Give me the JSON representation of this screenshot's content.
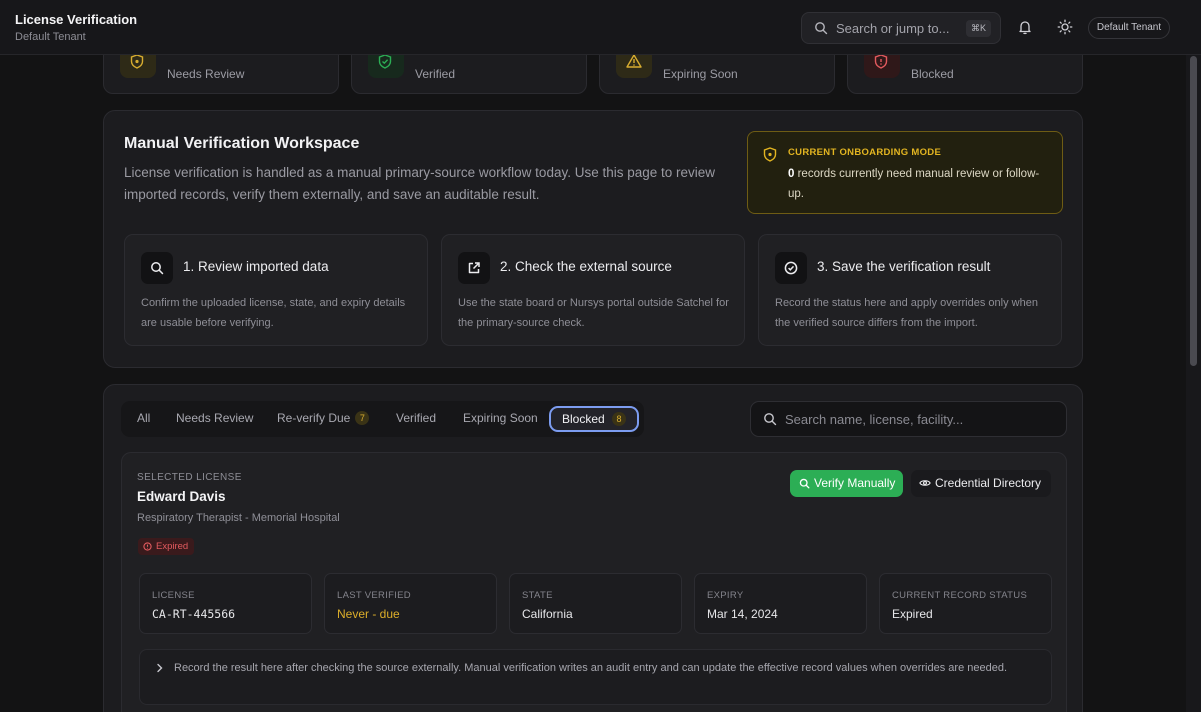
{
  "header": {
    "title": "License Verification",
    "subtitle": "Default Tenant",
    "search_placeholder": "Search or jump to...",
    "search_shortcut": "⌘K",
    "tenant_label": "Default Tenant",
    "icons": [
      "search-icon",
      "bell-icon",
      "sun-icon"
    ]
  },
  "stats": [
    {
      "label": "Needs Review",
      "icon": "shield-icon",
      "color": "#d8ad30"
    },
    {
      "label": "Verified",
      "icon": "shield-check-icon",
      "color": "#2cae55"
    },
    {
      "label": "Expiring Soon",
      "icon": "warning-icon",
      "color": "#d8ad30"
    },
    {
      "label": "Blocked",
      "icon": "shield-alert-icon",
      "color": "#e25a5e"
    }
  ],
  "workspace": {
    "title": "Manual Verification Workspace",
    "description": "License verification is handled as a manual primary-source workflow today. Use this page to review imported records, verify them externally, and save an auditable result.",
    "mode": {
      "title": "CURRENT ONBOARDING MODE",
      "count": "0",
      "text": " records currently need manual review or follow-up."
    },
    "steps": [
      {
        "title": "1. Review imported data",
        "text": "Confirm the uploaded license, state, and expiry details are usable before verifying.",
        "icon": "search-icon"
      },
      {
        "title": "2. Check the external source",
        "text": "Use the state board or Nursys portal outside Satchel for the primary-source check.",
        "icon": "external-link-icon"
      },
      {
        "title": "3. Save the verification result",
        "text": "Record the status here and apply overrides only when the verified source differs from the import.",
        "icon": "check-circle-icon"
      }
    ]
  },
  "tabs": [
    {
      "label": "All"
    },
    {
      "label": "Needs Review"
    },
    {
      "label": "Re-verify Due",
      "count": "7"
    },
    {
      "label": "Verified"
    },
    {
      "label": "Expiring Soon"
    },
    {
      "label": "Blocked",
      "count": "8",
      "active": true
    }
  ],
  "list_search_placeholder": "Search name, license, facility...",
  "selected": {
    "label": "SELECTED LICENSE",
    "name": "Edward Davis",
    "role": "Respiratory Therapist - Memorial Hospital",
    "status_badge": "Expired",
    "verify_button": "Verify Manually",
    "directory_button": "Credential Directory",
    "fields": [
      {
        "label": "LICENSE",
        "value": "CA-RT-445566"
      },
      {
        "label": "LAST VERIFIED",
        "value": "Never - due"
      },
      {
        "label": "STATE",
        "value": "California"
      },
      {
        "label": "EXPIRY",
        "value": "Mar 14, 2024"
      },
      {
        "label": "CURRENT RECORD STATUS",
        "value": "Expired"
      }
    ],
    "note": "Record the result here after checking the source externally. Manual verification writes an audit entry and can update the effective record values when overrides are needed."
  }
}
